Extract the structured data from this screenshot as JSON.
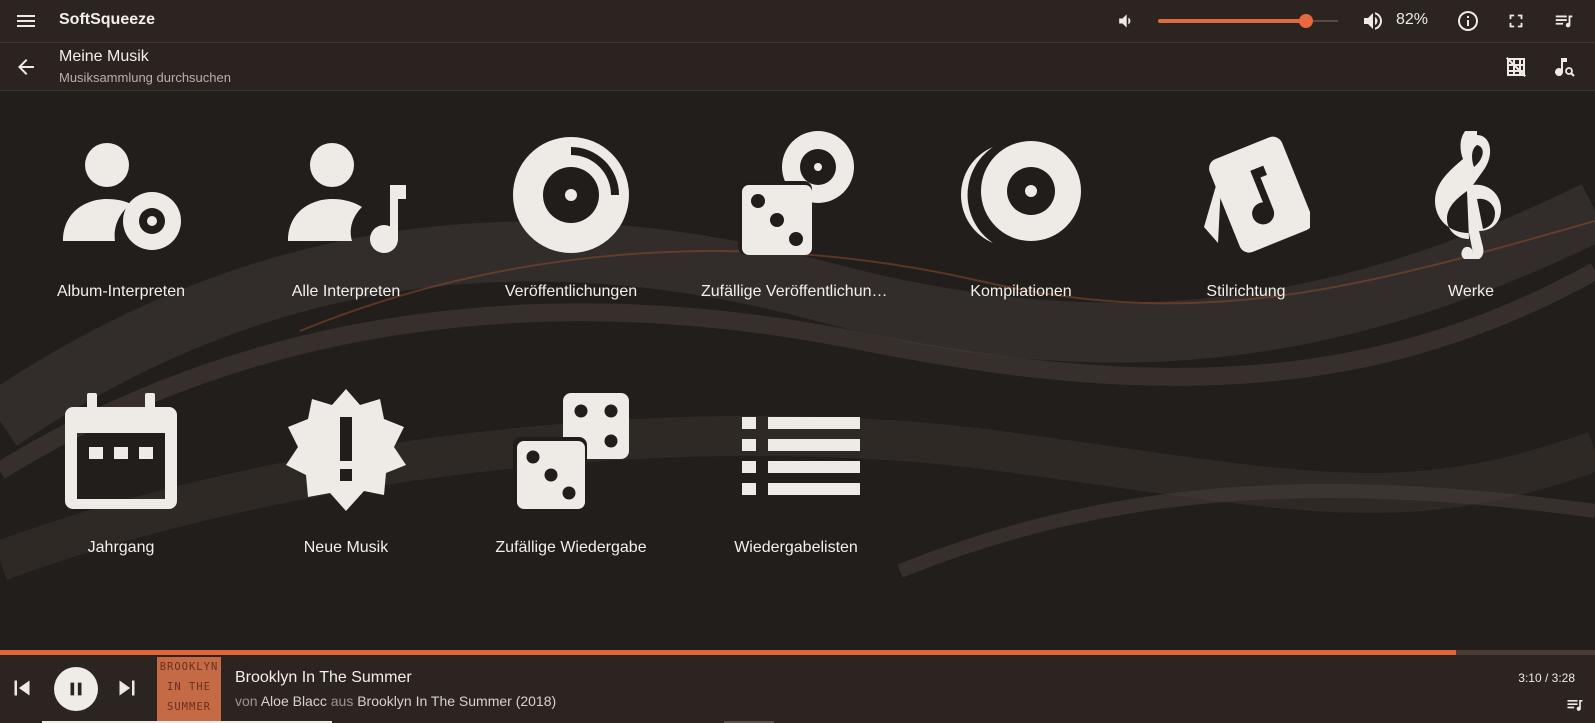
{
  "app": {
    "title": "SoftSqueeze",
    "volume_percent": 82,
    "volume_label": "82%",
    "accent_color": "#e06a42"
  },
  "toolbar": {
    "title": "Meine Musik",
    "subtitle": "Musiksammlung durchsuchen"
  },
  "browse_items": [
    {
      "label": "Album-Interpreten",
      "icon": "album-artist-icon"
    },
    {
      "label": "Alle Interpreten",
      "icon": "artist-music-icon"
    },
    {
      "label": "Veröffentlichungen",
      "icon": "album-disc-icon"
    },
    {
      "label": "Zufällige Veröffentlichungen",
      "icon": "random-album-icon"
    },
    {
      "label": "Kompilationen",
      "icon": "compilations-icon"
    },
    {
      "label": "Stilrichtung",
      "icon": "genre-icon"
    },
    {
      "label": "Werke",
      "icon": "treble-clef-icon"
    },
    {
      "label": "Jahrgang",
      "icon": "calendar-icon"
    },
    {
      "label": "Neue Musik",
      "icon": "new-badge-icon"
    },
    {
      "label": "Zufällige Wiedergabe",
      "icon": "dice-icon"
    },
    {
      "label": "Wiedergabelisten",
      "icon": "list-icon"
    }
  ],
  "now_playing": {
    "title": "Brooklyn In The Summer",
    "by_prefix": "von",
    "artist": "Aloe Blacc",
    "from_prefix": "aus",
    "album": "Brooklyn In The Summer (2018)",
    "time": "3:10 / 3:28",
    "progress_fraction": 0.913,
    "cover_text": [
      "BROOKLYN",
      "IN THE",
      "SUMMER"
    ]
  }
}
